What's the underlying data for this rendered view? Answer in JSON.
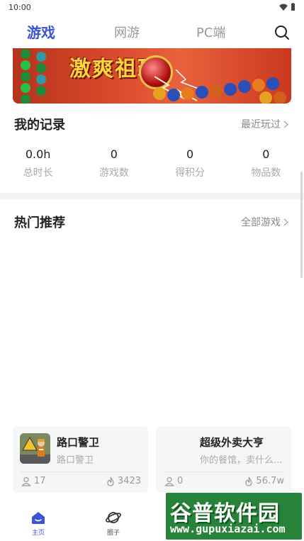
{
  "status_bar": {
    "time": "10:00"
  },
  "top_tabs": [
    {
      "label": "游戏",
      "active": true
    },
    {
      "label": "网游",
      "active": false
    },
    {
      "label": "PC端",
      "active": false
    }
  ],
  "banner": {
    "title": "激爽祖玛"
  },
  "records": {
    "title": "我的记录",
    "link": "最近玩过",
    "stats": [
      {
        "value": "0.0h",
        "label": "总时长"
      },
      {
        "value": "0",
        "label": "游戏数"
      },
      {
        "value": "0",
        "label": "得积分"
      },
      {
        "value": "0",
        "label": "物品数"
      }
    ]
  },
  "hot": {
    "title": "热门推荐",
    "link": "全部游戏"
  },
  "cards": [
    {
      "name": "路口警卫",
      "subtitle": "路口警卫",
      "players": "17",
      "heat": "3423"
    },
    {
      "name": "超级外卖大亨",
      "subtitle": "你的餐馆，卖什么...",
      "players": "0",
      "heat": "56.7w"
    }
  ],
  "bottom_nav": [
    {
      "label": "主页",
      "active": true
    },
    {
      "label": "圈子",
      "active": false
    }
  ],
  "watermark": {
    "title": "谷普软件园",
    "url": "www.gupuxiazai.com"
  },
  "colors": {
    "accent": "#3b55d6",
    "watermark": "#14782a"
  }
}
